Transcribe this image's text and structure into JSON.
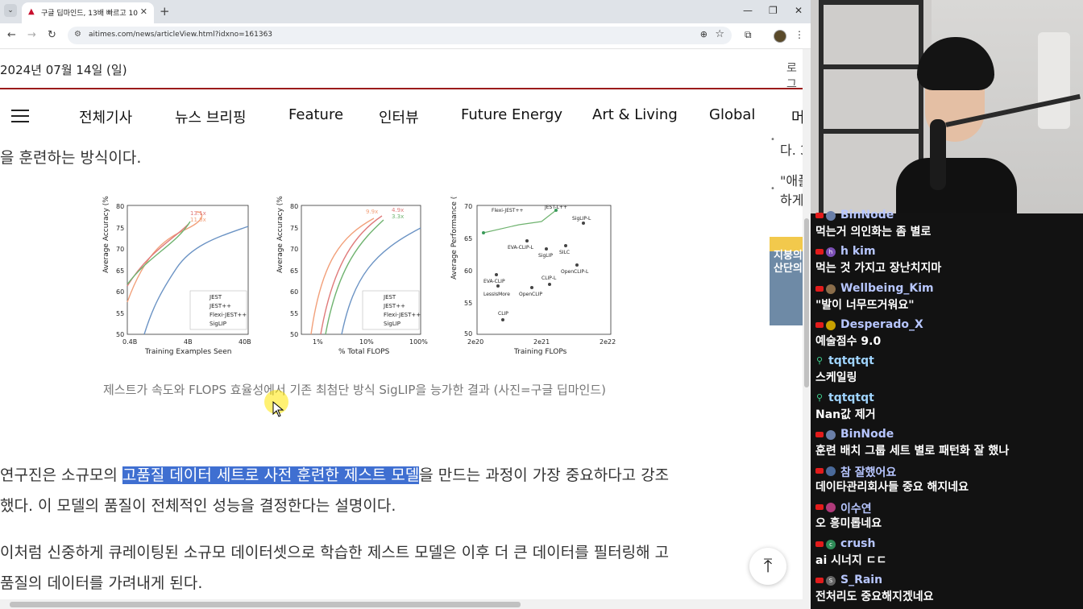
{
  "browser": {
    "tab_title": "구글 딥마인드, 13배 빠르고 10",
    "tab_close": "✕",
    "new_tab": "+",
    "url": "aitimes.com/news/articleView.html?idxno=161363"
  },
  "site": {
    "date": "2024년 07월 14일 (일)",
    "login": "로그",
    "menu": [
      "전체기사",
      "뉴스 브리핑",
      "Feature",
      "인터뷰",
      "Future Energy",
      "Art & Living",
      "Global",
      "머"
    ]
  },
  "article": {
    "para0": "을 훈련하는 방식이다.",
    "caption": "제스트가 속도와 FLOPS 효율성에서 기존 최첨단 방식 SigLIP을 능가한 결과 (사진=구글 딥마인드)",
    "para1_pre": "연구진은 소규모의 ",
    "para1_highlight": "고품질 데이터 세트로 사전 훈련한 제스트 모델",
    "para1_post": "을 만드는 과정이 가장 중요하다고 강조",
    "para1_line2": "했다. 이 모델의 품질이 전체적인 성능을 결정한다는 설명이다.",
    "para2_line1": "이처럼 신중하게 큐레이팅된 소규모 데이터셋으로 학습한 제스트 모델은 이후 더 큰 데이터를 필터링해 고",
    "para2_line2": "품질의 데이터를 가려내게 된다."
  },
  "sidebar": {
    "item1": "다. 3",
    "item2a": "\"애플",
    "item2b": "하게",
    "ad_text": "지붕의 산단의"
  },
  "figure": {
    "panel1": {
      "ylabel": "Average Accuracy (%)",
      "xlabel": "Training Examples Seen",
      "yticks": [
        "80",
        "75",
        "70",
        "65",
        "60",
        "55",
        "50"
      ],
      "xticks": [
        "0.4B",
        "4B",
        "40B"
      ],
      "legend": [
        "JEST",
        "JEST++",
        "Flexi-JEST++",
        "SigLIP"
      ],
      "annot": [
        "13.1x",
        "11.8x"
      ]
    },
    "panel2": {
      "ylabel": "Average Accuracy (%)",
      "xlabel": "% Total FLOPS",
      "yticks": [
        "80",
        "75",
        "70",
        "65",
        "60",
        "55",
        "50"
      ],
      "xticks": [
        "1%",
        "10%",
        "100%"
      ],
      "legend": [
        "JEST",
        "JEST++",
        "Flexi-JEST++",
        "SigLIP"
      ],
      "annot": [
        "9.9x",
        "4.9x",
        "3.3x"
      ]
    },
    "panel3": {
      "ylabel": "Average Performance (%)",
      "xlabel": "Training FLOPs",
      "yticks": [
        "70",
        "65",
        "60",
        "55",
        "50"
      ],
      "xticks": [
        "2e20",
        "2e21",
        "2e22"
      ],
      "points": [
        "Flexi-JEST++",
        "JEST-L++",
        "SigLIP-L",
        "EVA-CLIP-L",
        "SigLIP",
        "SILC",
        "EVA-CLIP",
        "OpenCLIP-L",
        "CLIP-L",
        "LessIsMore",
        "OpenCLIP",
        "CLIP"
      ]
    }
  },
  "chat": [
    {
      "name": "BinNode",
      "text": "먹는거 의인화는 좀 별로",
      "type": "yt",
      "avatar_color": "#6a7fa8",
      "avatar": ""
    },
    {
      "name": "h kim",
      "text": "먹는 것 가지고 장난치지마",
      "type": "yt",
      "avatar_color": "#7b4fb5",
      "avatar": "h"
    },
    {
      "name": "Wellbeing_Kim",
      "text": "\"발이 너무뜨거워요\"",
      "type": "yt",
      "avatar_color": "#8a6d4a",
      "avatar": ""
    },
    {
      "name": "Desperado_X",
      "text": "예술점수 9.0",
      "type": "yt",
      "avatar_color": "#c8a000",
      "avatar": ""
    },
    {
      "name": "tqtqtqt",
      "text": "스케일링",
      "type": "chk",
      "avatar_color": "",
      "avatar": ""
    },
    {
      "name": "tqtqtqt",
      "text": "Nan값 제거",
      "type": "chk",
      "avatar_color": "",
      "avatar": ""
    },
    {
      "name": "BinNode",
      "text": "훈련 배치 그룹 세트 별로 패턴화 잘 했나",
      "type": "yt",
      "avatar_color": "#6a7fa8",
      "avatar": ""
    },
    {
      "name": "참 잘했어요",
      "text": "데이타관리회사들 중요 해지네요",
      "type": "yt",
      "avatar_color": "#4a6a9a",
      "avatar": ""
    },
    {
      "name": "이수연",
      "text": "오 흥미롭네요",
      "type": "yt",
      "avatar_color": "#b03a7a",
      "avatar": ""
    },
    {
      "name": "crush",
      "text": "ai 시너지 ㄷㄷ",
      "type": "yt",
      "avatar_color": "#2e8b57",
      "avatar": "c"
    },
    {
      "name": "S_Rain",
      "text": "전처리도 중요해지겠네요",
      "type": "yt",
      "avatar_color": "#666666",
      "avatar": "S"
    }
  ]
}
